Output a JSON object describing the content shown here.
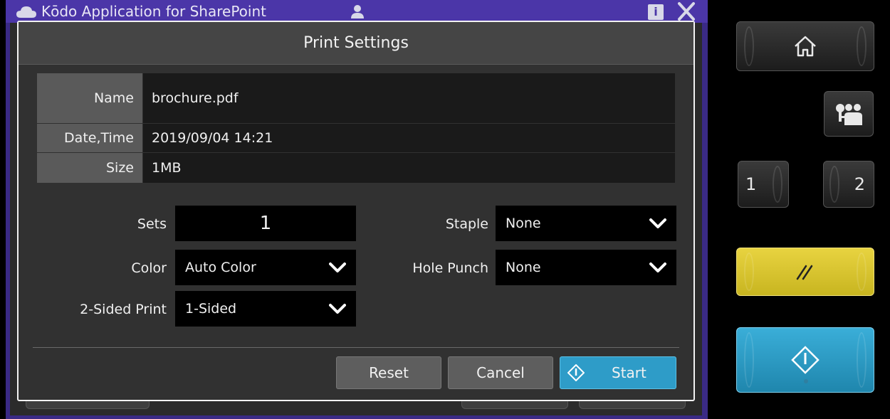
{
  "background_app": {
    "title": "Kōdo Application for SharePoint"
  },
  "dialog": {
    "title": "Print Settings",
    "info": {
      "name_label": "Name",
      "name_value": "brochure.pdf",
      "datetime_label": "Date,Time",
      "datetime_value": "2019/09/04 14:21",
      "size_label": "Size",
      "size_value": "1MB"
    },
    "fields": {
      "sets_label": "Sets",
      "sets_value": "1",
      "staple_label": "Staple",
      "staple_value": "None",
      "color_label": "Color",
      "color_value": "Auto Color",
      "hole_punch_label": "Hole Punch",
      "hole_punch_value": "None",
      "duplex_label": "2-Sided Print",
      "duplex_value": "1-Sided"
    },
    "buttons": {
      "reset": "Reset",
      "cancel": "Cancel",
      "start": "Start"
    }
  },
  "panel": {
    "memory_1": "1",
    "memory_2": "2"
  },
  "colors": {
    "app_purple": "#4b36a8",
    "start_blue": "#2e9cc8",
    "reset_yellow": "#e8d340"
  },
  "icons": [
    "cloud-icon",
    "user-icon",
    "info-icon",
    "close-icon",
    "chevron-down-icon",
    "start-diamond-icon",
    "home-icon",
    "user-access-icon",
    "reset-slash-icon"
  ]
}
